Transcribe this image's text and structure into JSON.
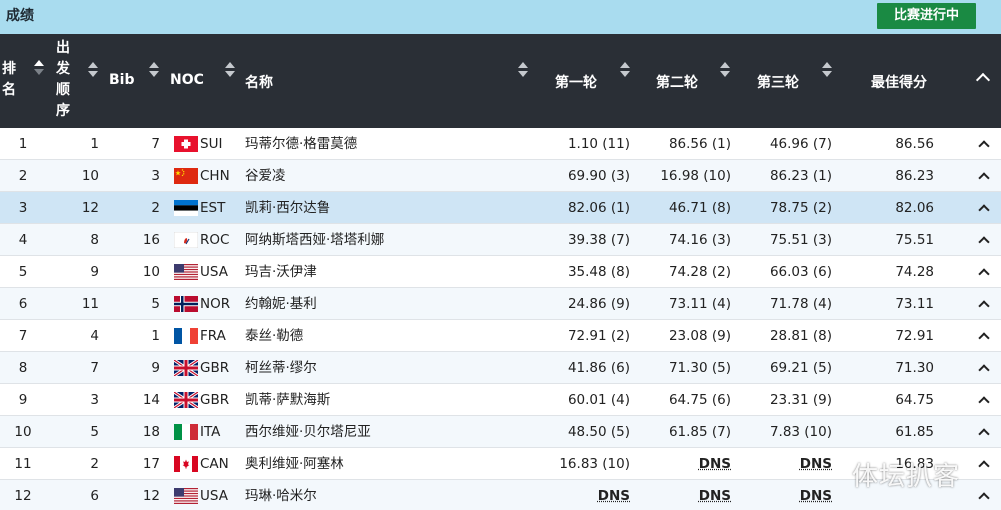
{
  "header": {
    "title": "成绩",
    "live_badge": "比赛进行中"
  },
  "columns": {
    "rank": [
      "排",
      "名"
    ],
    "order": [
      "出",
      "发",
      "顺",
      "序"
    ],
    "bib": "Bib",
    "noc": "NOC",
    "name": "名称",
    "r1": "第一轮",
    "r2": "第二轮",
    "r3": "第三轮",
    "best": "最佳得分"
  },
  "rows": [
    {
      "rank": "1",
      "order": "1",
      "bib": "7",
      "noc": "SUI",
      "flag": "sui",
      "name": "玛蒂尔德·格雷莫德",
      "r1": "1.10 (11)",
      "r2": "86.56 (1)",
      "r3": "46.96 (7)",
      "best": "86.56"
    },
    {
      "rank": "2",
      "order": "10",
      "bib": "3",
      "noc": "CHN",
      "flag": "chn",
      "name": "谷爱凌",
      "r1": "69.90 (3)",
      "r2": "16.98 (10)",
      "r3": "86.23 (1)",
      "best": "86.23"
    },
    {
      "rank": "3",
      "order": "12",
      "bib": "2",
      "noc": "EST",
      "flag": "est",
      "name": "凯莉·西尔达鲁",
      "r1": "82.06 (1)",
      "r2": "46.71 (8)",
      "r3": "78.75 (2)",
      "best": "82.06"
    },
    {
      "rank": "4",
      "order": "8",
      "bib": "16",
      "noc": "ROC",
      "flag": "roc",
      "name": "阿纳斯塔西娅·塔塔利娜",
      "r1": "39.38 (7)",
      "r2": "74.16 (3)",
      "r3": "75.51 (3)",
      "best": "75.51"
    },
    {
      "rank": "5",
      "order": "9",
      "bib": "10",
      "noc": "USA",
      "flag": "usa",
      "name": "玛吉·沃伊津",
      "r1": "35.48 (8)",
      "r2": "74.28 (2)",
      "r3": "66.03 (6)",
      "best": "74.28"
    },
    {
      "rank": "6",
      "order": "11",
      "bib": "5",
      "noc": "NOR",
      "flag": "nor",
      "name": "约翰妮·基利",
      "r1": "24.86 (9)",
      "r2": "73.11 (4)",
      "r3": "71.78 (4)",
      "best": "73.11"
    },
    {
      "rank": "7",
      "order": "4",
      "bib": "1",
      "noc": "FRA",
      "flag": "fra",
      "name": "泰丝·勒德",
      "r1": "72.91 (2)",
      "r2": "23.08 (9)",
      "r3": "28.81 (8)",
      "best": "72.91"
    },
    {
      "rank": "8",
      "order": "7",
      "bib": "9",
      "noc": "GBR",
      "flag": "gbr",
      "name": "柯丝蒂·缪尔",
      "r1": "41.86 (6)",
      "r2": "71.30 (5)",
      "r3": "69.21 (5)",
      "best": "71.30"
    },
    {
      "rank": "9",
      "order": "3",
      "bib": "14",
      "noc": "GBR",
      "flag": "gbr",
      "name": "凯蒂·萨默海斯",
      "r1": "60.01 (4)",
      "r2": "64.75 (6)",
      "r3": "23.31 (9)",
      "best": "64.75"
    },
    {
      "rank": "10",
      "order": "5",
      "bib": "18",
      "noc": "ITA",
      "flag": "ita",
      "name": "西尔维娅·贝尔塔尼亚",
      "r1": "48.50 (5)",
      "r2": "61.85 (7)",
      "r3": "7.83 (10)",
      "best": "61.85"
    },
    {
      "rank": "11",
      "order": "2",
      "bib": "17",
      "noc": "CAN",
      "flag": "can",
      "name": "奥利维娅·阿塞林",
      "r1": "16.83 (10)",
      "r2": "DNS",
      "r3": "DNS",
      "best": "16.83"
    },
    {
      "rank": "12",
      "order": "6",
      "bib": "12",
      "noc": "USA",
      "flag": "usa",
      "name": "玛琳·哈米尔",
      "r1": "DNS",
      "r2": "DNS",
      "r3": "DNS",
      "best": ""
    }
  ],
  "watermark": "体坛扒客",
  "colors": {
    "header_bg": "#2a2f36",
    "topbar_bg": "#a9dcef",
    "live_badge": "#1a8a43",
    "highlight_row": "#cfe5f5"
  }
}
